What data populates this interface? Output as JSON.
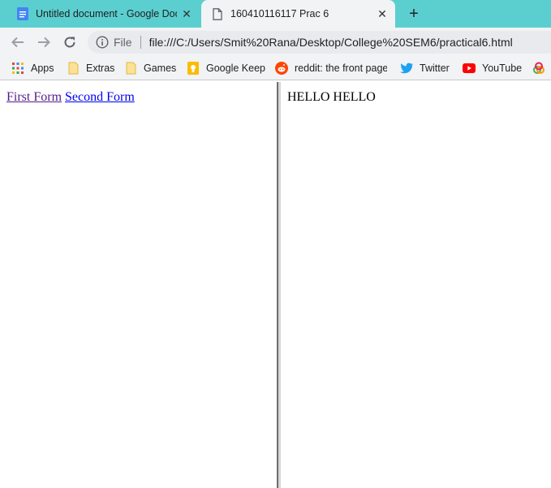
{
  "browser": {
    "tabs": [
      {
        "title": "Untitled document - Google Doc",
        "icon": "google-docs-icon",
        "active": false
      },
      {
        "title": "160410116117 Prac 6",
        "icon": "file-icon",
        "active": true
      }
    ],
    "close_glyph": "✕",
    "new_tab_glyph": "+",
    "address": {
      "scheme": "File",
      "url": "file:///C:/Users/Smit%20Rana/Desktop/College%20SEM6/practical6.html"
    },
    "bookmarks": [
      {
        "label": "Apps",
        "icon": "apps-grid-icon"
      },
      {
        "label": "Extras",
        "icon": "folder-icon"
      },
      {
        "label": "Games",
        "icon": "folder-icon"
      },
      {
        "label": "Google Keep",
        "icon": "google-keep-icon"
      },
      {
        "label": "reddit: the front page",
        "icon": "reddit-icon"
      },
      {
        "label": "Twitter",
        "icon": "twitter-icon"
      },
      {
        "label": "YouTube",
        "icon": "youtube-icon"
      }
    ]
  },
  "page": {
    "left_frame": {
      "links": [
        {
          "label": "First Form",
          "visited": true
        },
        {
          "label": "Second Form",
          "visited": false
        }
      ]
    },
    "right_frame": {
      "text": "HELLO HELLO"
    }
  },
  "colors": {
    "tab_strip": "#5bcfd0",
    "toolbar": "#f1f3f4",
    "link_visited": "#551a8b",
    "link_unvisited": "#0000ee"
  }
}
